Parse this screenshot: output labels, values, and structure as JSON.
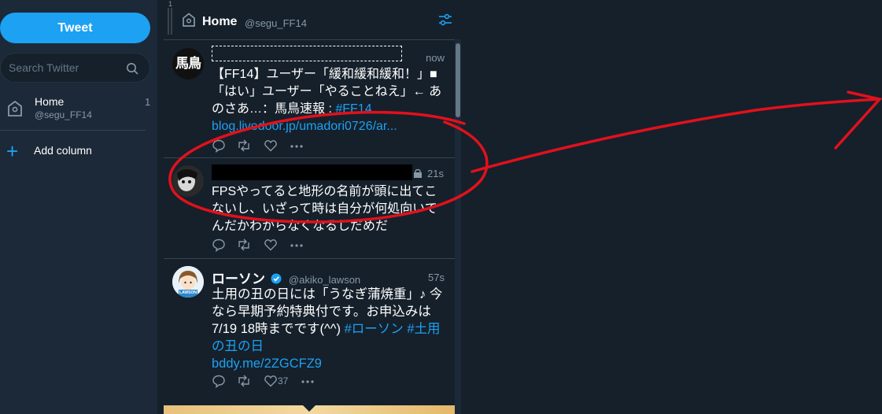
{
  "sidebar": {
    "tweet_label": "Tweet",
    "search_placeholder": "Search Twitter",
    "column_item": {
      "title": "Home",
      "handle": "@segu_FF14",
      "count": "1"
    },
    "add_column_label": "Add column"
  },
  "column": {
    "index": "1",
    "title": "Home",
    "handle": "@segu_FF14"
  },
  "tweets": [
    {
      "avatar_text": "馬鳥",
      "time": "now",
      "body_text": "【FF14】ユーザー「緩和緩和緩和！」■「はい」ユーザー「やることねえ」← あのさあ…：馬鳥速報 : ",
      "body_tag": "#FF14",
      "link": "blog.livedoor.jp/umadori0726/ar..."
    },
    {
      "time": "21s",
      "body_text": "FPSやってると地形の名前が頭に出てこないし、いざって時は自分が何処向いてんだかわからなくなるしだめだ"
    },
    {
      "name": "ローソン",
      "handle": "@akiko_lawson",
      "time": "57s",
      "body_text": "土用の丑の日には「うなぎ蒲焼重」♪ 今なら早期予約特典付です。お申込みは7/19 18時までです(^^) ",
      "body_tag": "#ローソン #土用の丑の日",
      "link": "bddy.me/2ZGCFZ9",
      "like_count": "37",
      "avatar_label": "LAWSON"
    }
  ],
  "colors": {
    "accent": "#1da1f2",
    "background": "#15202b",
    "sidebar": "#1c2938",
    "annotation": "#e0111c"
  }
}
